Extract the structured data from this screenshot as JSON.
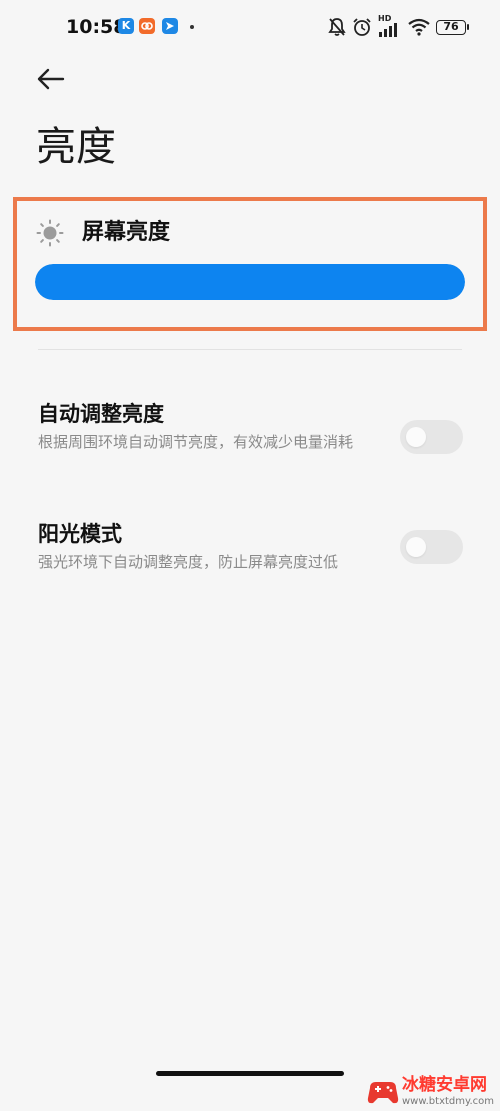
{
  "status_bar": {
    "time": "10:58",
    "battery": "76",
    "network_label": "HD"
  },
  "page": {
    "title": "亮度"
  },
  "brightness": {
    "label": "屏幕亮度",
    "level_fraction": 1.0,
    "accent_color": "#0d84f0",
    "highlight_color": "#ec7a4b"
  },
  "settings": [
    {
      "title": "自动调整亮度",
      "description": "根据周围环境自动调节亮度，有效减少电量消耗",
      "enabled": false
    },
    {
      "title": "阳光模式",
      "description": "强光环境下自动调整亮度，防止屏幕亮度过低",
      "enabled": false
    }
  ],
  "watermark": {
    "name": "冰糖安卓网",
    "url": "www.btxtdmy.com"
  }
}
